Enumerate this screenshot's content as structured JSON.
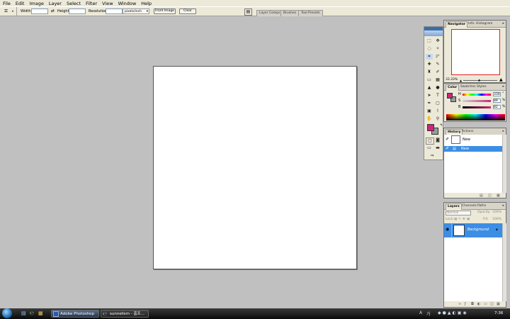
{
  "menubar": {
    "items": [
      "File",
      "Edit",
      "Image",
      "Layer",
      "Select",
      "Filter",
      "View",
      "Window",
      "Help"
    ]
  },
  "options": {
    "width_label": "Width:",
    "height_label": "Height:",
    "resolution_label": "Resolution:",
    "units_value": "pixels/inch",
    "front_image": "Front Image",
    "clear": "Clear",
    "well_tabs": [
      "Layer Comps",
      "Brushes",
      "Tool Presets"
    ]
  },
  "navigator": {
    "tabs": [
      "Navigator",
      "Info",
      "Histogram"
    ],
    "zoom": "33.33%"
  },
  "color": {
    "tabs": [
      "Color",
      "Swatches",
      "Styles"
    ],
    "sliders": [
      {
        "label": "H",
        "value": "330",
        "unit": "°"
      },
      {
        "label": "S",
        "value": "89",
        "unit": "%"
      },
      {
        "label": "B",
        "value": "82",
        "unit": "%"
      }
    ],
    "fg_color": "#d0257a",
    "bg_color": "#9a9a9a"
  },
  "history": {
    "tabs": [
      "History",
      "Actions"
    ],
    "snapshot": "New",
    "states": [
      "New"
    ]
  },
  "layers": {
    "tabs": [
      "Layers",
      "Channels",
      "Paths"
    ],
    "blend_mode": "Normal",
    "opacity_label": "Opacity:",
    "opacity_value": "100%",
    "lock_label": "Lock:",
    "fill_label": "Fill:",
    "fill_value": "100%",
    "rows": [
      {
        "name": "Background"
      }
    ]
  },
  "taskbar": {
    "tasks": [
      "Adobe Photoshop",
      "sunnelism - 홈프..."
    ],
    "clock": "7:36"
  },
  "accent": "#3c8ee5"
}
